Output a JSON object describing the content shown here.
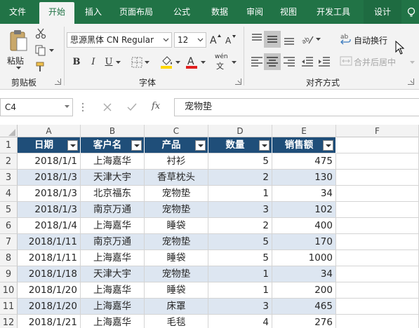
{
  "tabs": [
    {
      "label": "文件"
    },
    {
      "label": "开始"
    },
    {
      "label": "插入"
    },
    {
      "label": "页面布局"
    },
    {
      "label": "公式"
    },
    {
      "label": "数据"
    },
    {
      "label": "审阅"
    },
    {
      "label": "视图"
    },
    {
      "label": "开发工具"
    },
    {
      "label": "设计"
    }
  ],
  "ribbon": {
    "clipboard": {
      "group_label": "剪贴板",
      "paste_label": "粘贴"
    },
    "font": {
      "group_label": "字体",
      "font_name": "思源黑体 CN Regular",
      "font_size": "12",
      "bold": "B",
      "italic": "I",
      "underline": "U",
      "font_color": "#e02020",
      "fill_color": "#ffd700",
      "phonetic_label": "wén"
    },
    "alignment": {
      "group_label": "对齐方式",
      "wrap_text": "自动换行",
      "merge_center": "合并后居中"
    }
  },
  "formula_bar": {
    "name_box": "C4",
    "fx": "fx",
    "content": "宠物垫"
  },
  "grid": {
    "columns": [
      "A",
      "B",
      "C",
      "D",
      "E",
      "F"
    ],
    "header": [
      "日期",
      "客户名",
      "产品",
      "数量",
      "销售额"
    ],
    "rows": [
      {
        "n": "2",
        "cells": [
          "2018/1/1",
          "上海嘉华",
          "衬衫",
          "5",
          "475"
        ]
      },
      {
        "n": "3",
        "cells": [
          "2018/1/3",
          "天津大宇",
          "香草枕头",
          "2",
          "130"
        ]
      },
      {
        "n": "4",
        "cells": [
          "2018/1/3",
          "北京福东",
          "宠物垫",
          "1",
          "34"
        ]
      },
      {
        "n": "5",
        "cells": [
          "2018/1/3",
          "南京万通",
          "宠物垫",
          "3",
          "102"
        ]
      },
      {
        "n": "6",
        "cells": [
          "2018/1/4",
          "上海嘉华",
          "睡袋",
          "2",
          "400"
        ]
      },
      {
        "n": "7",
        "cells": [
          "2018/1/11",
          "南京万通",
          "宠物垫",
          "5",
          "170"
        ]
      },
      {
        "n": "8",
        "cells": [
          "2018/1/11",
          "上海嘉华",
          "睡袋",
          "5",
          "1000"
        ]
      },
      {
        "n": "9",
        "cells": [
          "2018/1/18",
          "天津大宇",
          "宠物垫",
          "1",
          "34"
        ]
      },
      {
        "n": "10",
        "cells": [
          "2018/1/20",
          "上海嘉华",
          "睡袋",
          "1",
          "200"
        ]
      },
      {
        "n": "11",
        "cells": [
          "2018/1/20",
          "上海嘉华",
          "床罩",
          "3",
          "465"
        ]
      },
      {
        "n": "12",
        "cells": [
          "2018/1/21",
          "上海嘉华",
          "毛毯",
          "4",
          "276"
        ]
      }
    ]
  },
  "colors": {
    "accent": "#217346",
    "table_header": "#1f4e79",
    "band": "#dde6f1"
  }
}
